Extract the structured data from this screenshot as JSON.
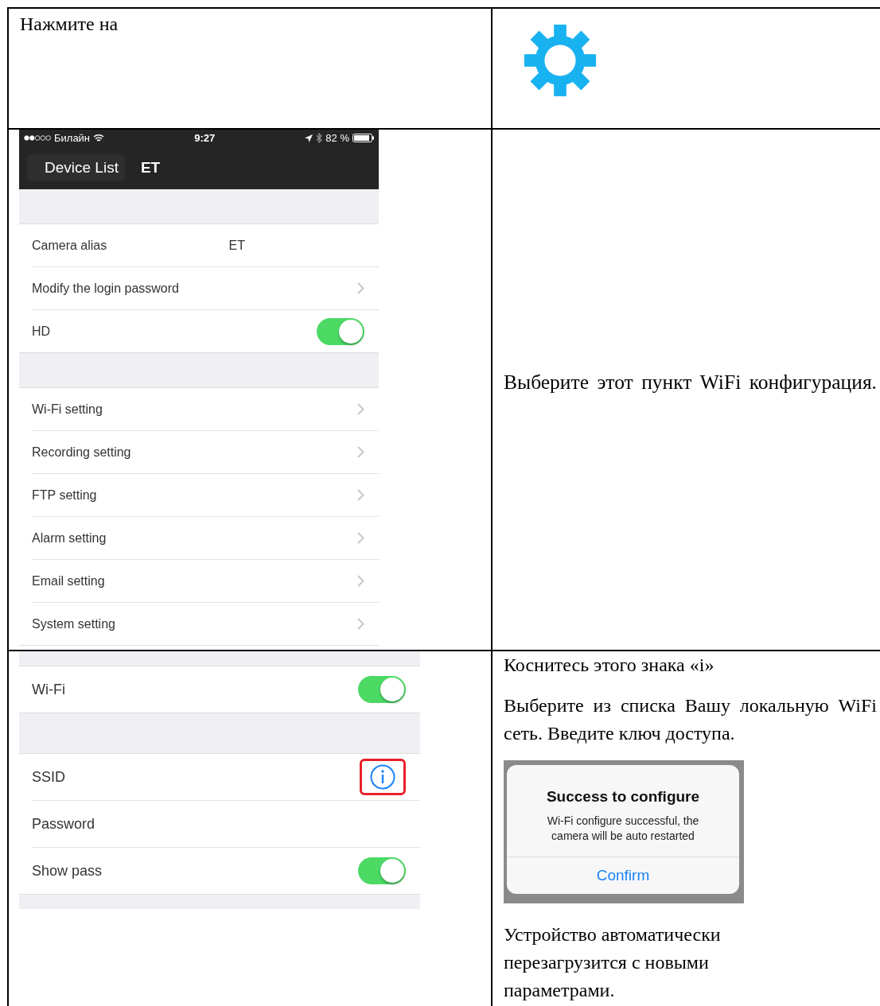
{
  "step_1": {
    "text": "Нажмите на"
  },
  "step_2": {
    "screen": {
      "status_bar": {
        "carrier": "Билайн",
        "time": "9:27",
        "battery": "82 %"
      },
      "nav": {
        "back": "Device List",
        "title": "ET"
      },
      "groups": [
        {
          "items": [
            {
              "label": "Camera alias",
              "kind": "value",
              "value": "ET"
            },
            {
              "label": "Modify the login password",
              "kind": "link"
            },
            {
              "label": "HD",
              "kind": "toggle",
              "on": true
            }
          ]
        },
        {
          "items": [
            {
              "label": "Wi-Fi setting",
              "kind": "link"
            },
            {
              "label": "Recording setting",
              "kind": "link"
            },
            {
              "label": "FTP setting",
              "kind": "link"
            },
            {
              "label": "Alarm setting",
              "kind": "link"
            },
            {
              "label": "Email setting",
              "kind": "link"
            },
            {
              "label": "System setting",
              "kind": "link"
            }
          ]
        }
      ]
    },
    "text": "Выберите этот пункт WiFi конфигурация."
  },
  "step_3": {
    "screen": {
      "groups": [
        {
          "items": [
            {
              "label": "Wi-Fi",
              "kind": "toggle",
              "on": true
            }
          ]
        },
        {
          "items": [
            {
              "label": "SSID",
              "kind": "info",
              "highlighted": true
            },
            {
              "label": "Password",
              "kind": "text"
            },
            {
              "label": "Show pass",
              "kind": "toggle",
              "on": true
            }
          ]
        }
      ]
    },
    "paragraphs": [
      "Коснитесь этого знака «i»",
      "Выберите из списка Вашу локальную WiFi сеть. Введите ключ доступа."
    ],
    "dialog": {
      "title": "Success to configure",
      "message": "Wi-Fi configure successful, the camera will be auto restarted",
      "button": "Confirm"
    },
    "closing": "Устройство автоматически перезагрузится с новыми параметрами."
  }
}
